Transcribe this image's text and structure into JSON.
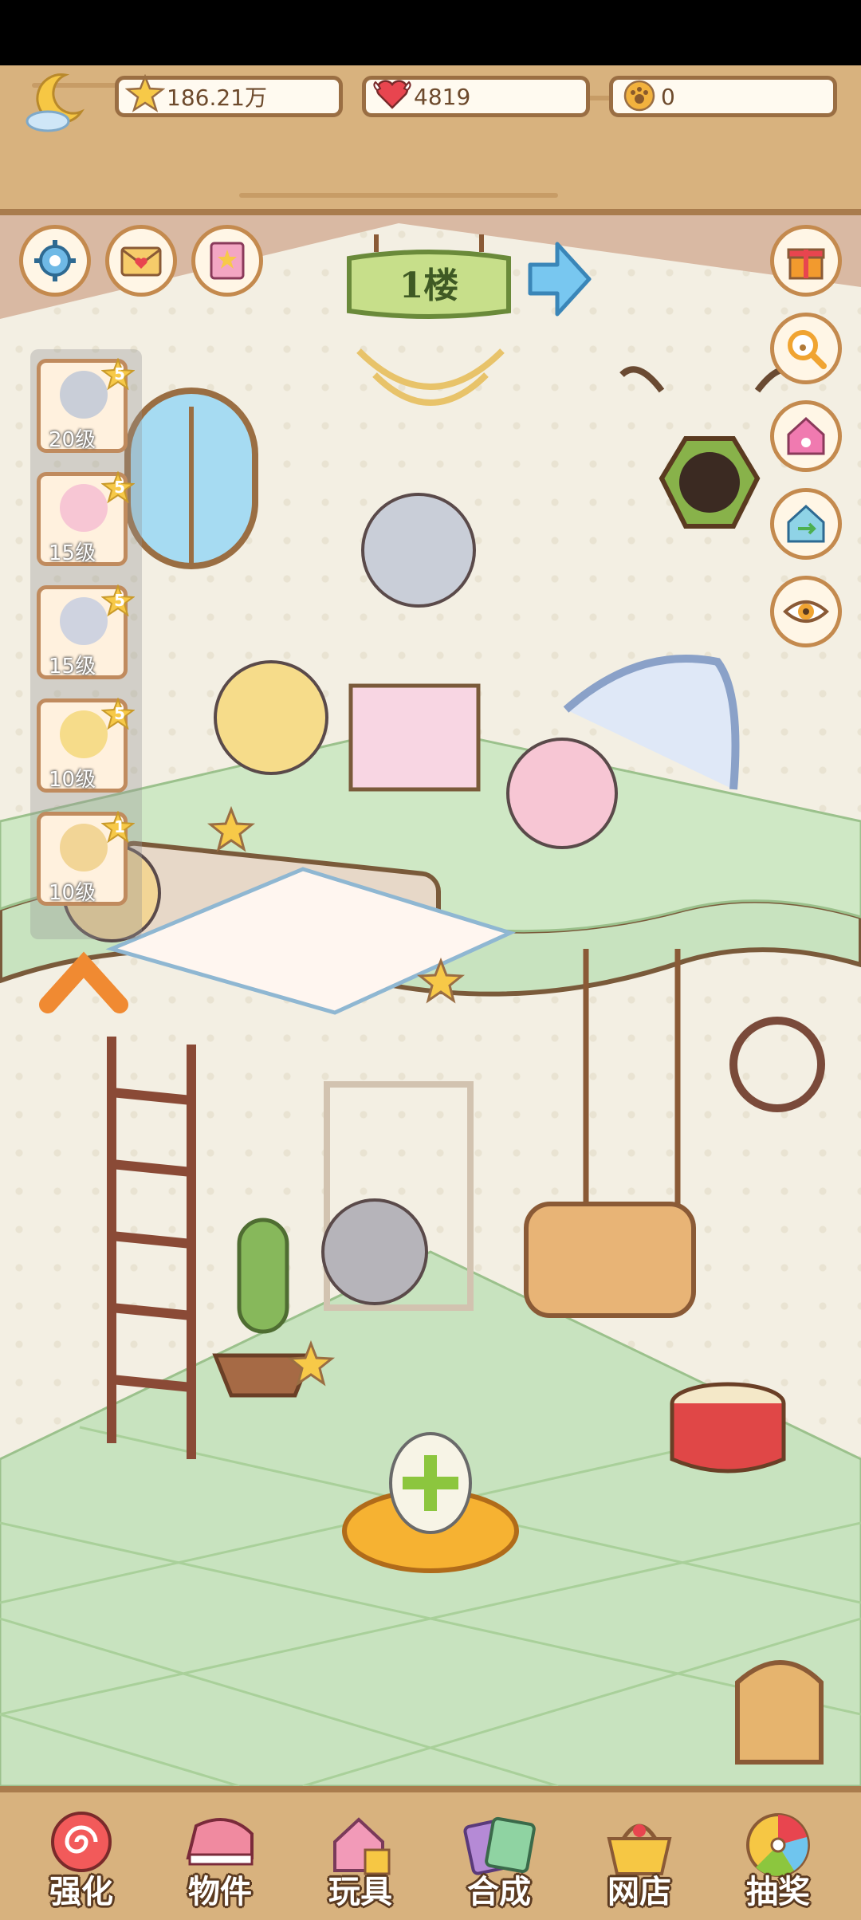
{
  "resources": {
    "stars": "186.21万",
    "hearts": "4819",
    "paw_coins": "0"
  },
  "floor": {
    "label": "1楼"
  },
  "top_left_buttons": [
    "gear-icon",
    "mail-icon",
    "book-icon"
  ],
  "right_buttons": [
    "gift-icon",
    "magnifier-paw-icon",
    "home-paw-icon",
    "house-swap-icon",
    "eye-icon"
  ],
  "characters": [
    {
      "level_label": "20级",
      "stars": "5"
    },
    {
      "level_label": "15级",
      "stars": "5"
    },
    {
      "level_label": "15级",
      "stars": "5"
    },
    {
      "level_label": "10级",
      "stars": "5"
    },
    {
      "level_label": "10级",
      "stars": "1"
    }
  ],
  "bottom_nav": [
    {
      "label": "强化",
      "icon": "lollipop-icon"
    },
    {
      "label": "物件",
      "icon": "piano-icon"
    },
    {
      "label": "玩具",
      "icon": "toy-house-icon"
    },
    {
      "label": "合成",
      "icon": "cards-icon"
    },
    {
      "label": "网店",
      "icon": "shop-basket-icon"
    },
    {
      "label": "抽奖",
      "icon": "wheel-icon"
    }
  ],
  "colors": {
    "wood": "#d8b27e",
    "wood_dark": "#a97c4d",
    "floor_green": "#c8e3bf",
    "accent_blue": "#6fc5ee"
  }
}
